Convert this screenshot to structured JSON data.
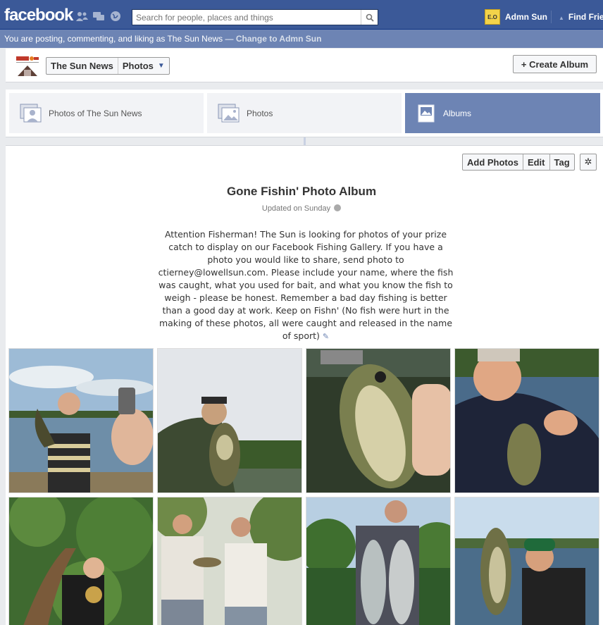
{
  "topbar": {
    "logo": "facebook",
    "search_placeholder": "Search for people, places and things",
    "user_name": "Admn Sun",
    "find_friends": "Find Friends",
    "avatar_text": "E.O"
  },
  "posting_bar": {
    "text": "You are posting, commenting, and liking as The Sun News — ",
    "change_link": "Change to Admn Sun"
  },
  "page_header": {
    "page_name": "The Sun News",
    "section": "Photos",
    "create_album": "+ Create Album"
  },
  "tabs": [
    {
      "label": "Photos of The Sun News",
      "active": false
    },
    {
      "label": "Photos",
      "active": false
    },
    {
      "label": "Albums",
      "active": true
    }
  ],
  "album": {
    "buttons": [
      "Add Photos",
      "Edit",
      "Tag"
    ],
    "title": "Gone Fishin' Photo Album",
    "updated": "Updated on Sunday",
    "description": "Attention Fisherman! The Sun is looking for photos of your prize catch to display on our Facebook Fishing Gallery. If you have a photo you would like to share, send photo to ctierney@lowellsun.com. Please include your name, where the fish was caught, what you used for bait, and what you know the fish to weigh - please be honest. Remember a bad day fishing is better than a good day at work. Keep on Fishn' (No fish were hurt in the making of these photos, all were caught and released in the name of sport)"
  },
  "colors": {
    "brand_blue": "#3b5998",
    "posting_bar": "#6d84b4"
  }
}
